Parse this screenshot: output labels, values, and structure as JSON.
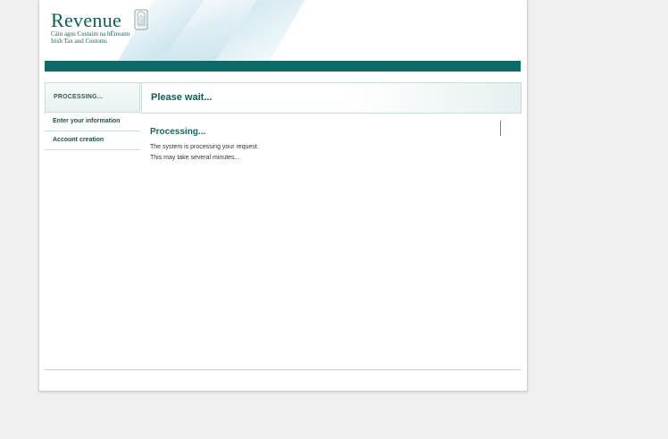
{
  "logo": {
    "title": "Revenue",
    "subtitle_ga": "Cáin agus Custaim na hÉireann",
    "subtitle_en": "Irish Tax and Customs",
    "icon": "harp-icon"
  },
  "colors": {
    "brand_teal": "#0b6b66",
    "brand_dark": "#0b5e5a",
    "divider": "#c9dcdc"
  },
  "sidebar": {
    "current_step": "PROCESSING...",
    "items": [
      {
        "label": "Enter your information"
      },
      {
        "label": "Account creation"
      }
    ]
  },
  "main": {
    "header_title": "Please wait...",
    "section_title": "Processing...",
    "message_line1": "The system is processing your request.",
    "message_line2": "This may take several minutes..."
  }
}
